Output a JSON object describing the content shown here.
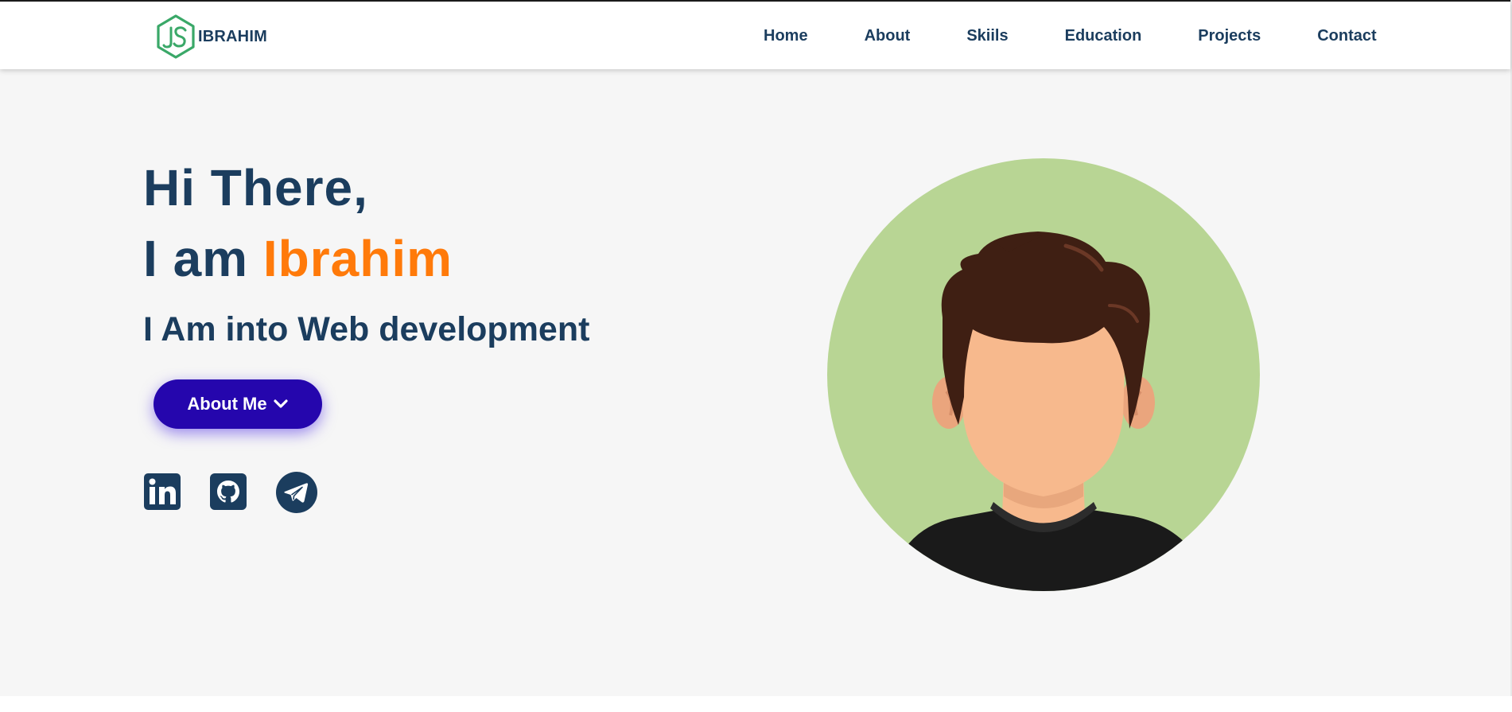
{
  "brand": {
    "name": "IBRAHIM",
    "logo_icon": "nodejs-hexagon-logo",
    "logo_color": "#3aa868"
  },
  "nav": {
    "items": [
      {
        "label": "Home"
      },
      {
        "label": "About"
      },
      {
        "label": "Skiils"
      },
      {
        "label": "Education"
      },
      {
        "label": "Projects"
      },
      {
        "label": "Contact"
      }
    ]
  },
  "hero": {
    "greeting_line1": "Hi There,",
    "greeting_prefix": "I am",
    "greeting_name": "Ibrahim",
    "subtitle": "I Am into Web development",
    "button_label": "About Me",
    "button_icon": "chevron-down-icon",
    "avatar_icon": "person-avatar-illustration"
  },
  "social": {
    "items": [
      {
        "icon": "linkedin-icon"
      },
      {
        "icon": "github-icon"
      },
      {
        "icon": "telegram-icon"
      }
    ]
  },
  "colors": {
    "primary_text": "#1b3d5e",
    "accent_orange": "#ff7a0a",
    "button_bg": "#2506ad",
    "hero_bg": "#f6f6f6",
    "avatar_bg": "#b8d594"
  }
}
